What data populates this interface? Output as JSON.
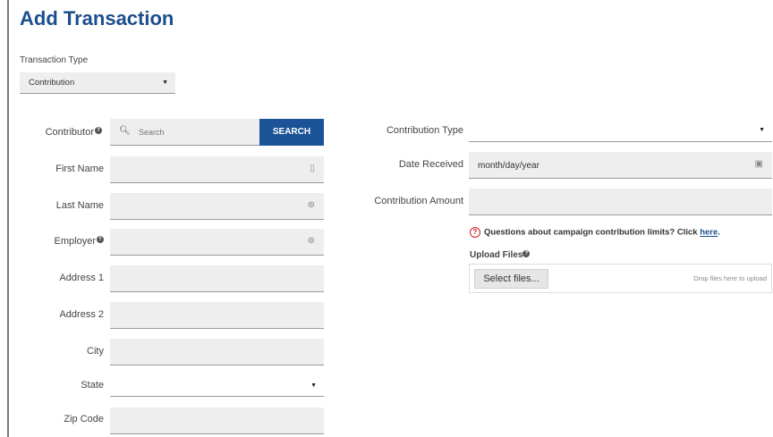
{
  "page": {
    "title": "Add Transaction"
  },
  "transaction_type": {
    "label": "Transaction Type",
    "value": "Contribution"
  },
  "left_form": {
    "contributor": {
      "label": "Contributor",
      "placeholder": "Search",
      "button": "SEARCH"
    },
    "first_name": {
      "label": "First Name"
    },
    "last_name": {
      "label": "Last Name"
    },
    "employer": {
      "label": "Employer"
    },
    "address1": {
      "label": "Address 1"
    },
    "address2": {
      "label": "Address 2"
    },
    "city": {
      "label": "City"
    },
    "state": {
      "label": "State",
      "value": ""
    },
    "zip": {
      "label": "Zip Code"
    }
  },
  "right_form": {
    "contribution_type": {
      "label": "Contribution Type",
      "value": ""
    },
    "date_received": {
      "label": "Date Received",
      "placeholder": "month/day/year"
    },
    "contribution_amount": {
      "label": "Contribution Amount"
    },
    "limits_note": {
      "icon": "question-circle",
      "text": "Questions about campaign contribution limits? Click ",
      "link": "here",
      "suffix": "."
    },
    "upload": {
      "label": "Upload Files",
      "button": "Select files...",
      "hint": "Drop files here to upload"
    }
  },
  "colors": {
    "title": "#1c4f8e",
    "button": "#1c5396",
    "field_bg": "#eeeeee",
    "warning": "#cc2222"
  }
}
